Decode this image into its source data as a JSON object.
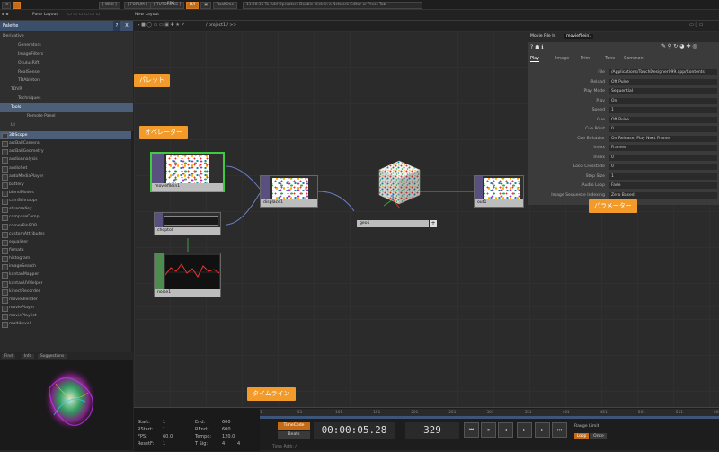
{
  "topbar": {
    "wiki": "[ WIKI ]",
    "forum": "[ FORUM ]",
    "tutorials": "[ TUTORIALS ]",
    "dj": "D/I",
    "fps_label": "FPS:",
    "fps_value": "60",
    "realtime": "Realtime",
    "message": "11:20:35 To Add Operators Double-click in a Network Editor or Press Tab"
  },
  "bar2": {
    "pane_layout": "Pane Layout",
    "new_layout": "New Layout"
  },
  "palette": {
    "title": "Palette",
    "help": "?",
    "close": "X",
    "categories": [
      {
        "label": "Derivative",
        "cls": ""
      },
      {
        "label": "Generators",
        "cls": ""
      },
      {
        "label": "ImageFilters",
        "cls": ""
      },
      {
        "label": "OculusRift",
        "cls": ""
      },
      {
        "label": "RealSense",
        "cls": ""
      },
      {
        "label": "TDAbleton",
        "cls": ""
      },
      {
        "label": "TDVR",
        "cls": ""
      },
      {
        "label": "Techniques",
        "cls": ""
      },
      {
        "label": "Tools",
        "cls": "sel"
      },
      {
        "label": "Remote Panel",
        "cls": ""
      },
      {
        "label": "UI",
        "cls": ""
      }
    ],
    "operators": [
      "3DScope",
      "arcBallCamera",
      "arcBallGeometry",
      "audioAnalysis",
      "audioSet",
      "autoMediaPlayer",
      "battery",
      "blendModes",
      "camSchnappr",
      "chromaKey",
      "compareComp",
      "cornerPinSOP",
      "customAttributes",
      "equalizer",
      "firmata",
      "histogram",
      "imageSearch",
      "kantanMapper",
      "kantanUVHelper",
      "kinectRecorder",
      "movieBlender",
      "moviePlayer",
      "moviePlaylist",
      "multiLevel"
    ]
  },
  "preview_tabs": {
    "tab1": "Find",
    "tab2": "Info",
    "tab3": "Suggestions"
  },
  "network": {
    "path": "/ project1 / >>",
    "nodes": {
      "moviefile": "moviefilein1",
      "displace": "displace1",
      "geo": "geo1",
      "out": "out1",
      "chopto": "choptol",
      "noise": "noise1"
    }
  },
  "callouts": {
    "palette": "パレット",
    "operator": "オペレーター",
    "parameter": "パラメーター",
    "timeline": "タイムライン"
  },
  "params": {
    "type": "Movie File In",
    "name": "moviefilein1",
    "tabs": [
      "Play",
      "Image",
      "Trim",
      "Tune",
      "Common"
    ],
    "rows": [
      {
        "label": "File",
        "value": "/Applications/TouchDesigner099.app/Contents"
      },
      {
        "label": "Reload",
        "value": "Off      Pulse"
      },
      {
        "label": "Play Mode",
        "value": "Sequential"
      },
      {
        "label": "Play",
        "value": "On"
      },
      {
        "label": "Speed",
        "value": "1"
      },
      {
        "label": "Cue",
        "value": "Off      Pulse"
      },
      {
        "label": "Cue Point",
        "value": "0"
      },
      {
        "label": "Cue Behavior",
        "value": "On Release, Play Next Frame"
      },
      {
        "label": "Index",
        "value": "Frames"
      },
      {
        "label": "Index",
        "value": "0"
      },
      {
        "label": "Loop Crossfade",
        "value": "0"
      },
      {
        "label": "Step Size",
        "value": "1"
      },
      {
        "label": "Audio Loop",
        "value": "Fade"
      },
      {
        "label": "Image Sequence Indexing",
        "value": "Zero Based"
      }
    ]
  },
  "timeline": {
    "start_label": "Start:",
    "start": "1",
    "end_label": "End:",
    "end": "600",
    "rstart_label": "RStart:",
    "rstart": "1",
    "rend_label": "REnd:",
    "rend": "600",
    "fps_label": "FPS:",
    "fps": "60.0",
    "tempo_label": "Tempo:",
    "tempo": "120.0",
    "resetf_label": "ResetF:",
    "resetf": "1",
    "tsig_label": "T Sig:",
    "tsig_a": "4",
    "tsig_b": "4",
    "timecode": "TimeCode",
    "beats": "Beats",
    "time": "00:00:05.28",
    "frame": "329",
    "range_limit": "Range Limit",
    "loop": "Loop",
    "once": "Once",
    "time_path": "Time Path: /",
    "ticks": [
      "1",
      "51",
      "101",
      "151",
      "201",
      "251",
      "301",
      "351",
      "401",
      "451",
      "501",
      "551",
      "600"
    ]
  }
}
